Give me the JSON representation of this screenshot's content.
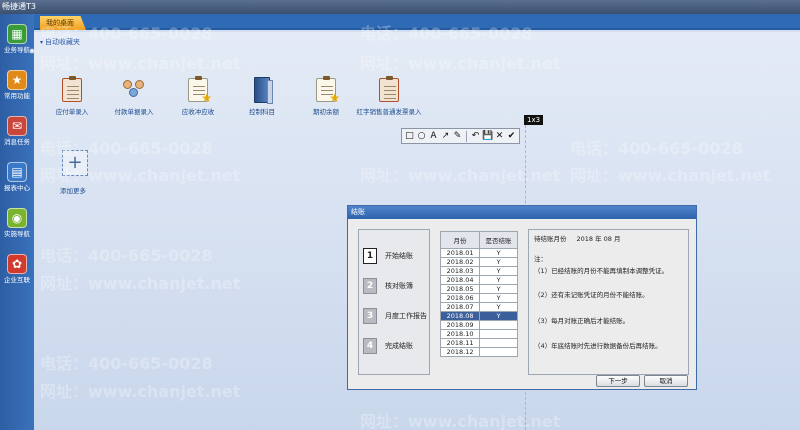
{
  "app": {
    "title": "畅捷通T3"
  },
  "sidebar": {
    "items": [
      {
        "label": "业务导航",
        "icon": "business-nav-icon",
        "glyph": "▦",
        "color": "#3a9b3a"
      },
      {
        "label": "常用功能",
        "icon": "star-icon",
        "glyph": "★",
        "color": "#e08a1a"
      },
      {
        "label": "消息任务",
        "icon": "task-icon",
        "glyph": "✉",
        "color": "#c8473a"
      },
      {
        "label": "报表中心",
        "icon": "report-icon",
        "glyph": "▤",
        "color": "#3a78c8"
      },
      {
        "label": "实施导航",
        "icon": "implement-nav-icon",
        "glyph": "◉",
        "color": "#7ab32e"
      },
      {
        "label": "企业互联",
        "icon": "enterprise-link-icon",
        "glyph": "✿",
        "color": "#d23a2e"
      }
    ]
  },
  "tabs": [
    {
      "label": "我的桌面"
    }
  ],
  "favorites": {
    "header": "自动收藏夹",
    "items": [
      {
        "label": "应付单录入"
      },
      {
        "label": "付款单据录入"
      },
      {
        "label": "应收冲应收"
      },
      {
        "label": "控制科目"
      },
      {
        "label": "期初余额"
      },
      {
        "label": "红字销售普通发票录入"
      }
    ],
    "add_label": "添加更多"
  },
  "screenshot_tool": {
    "size_badge": "1x3",
    "tools": [
      "□",
      "○",
      "A",
      "↗",
      "✎",
      "↶",
      "💾",
      "✕",
      "✔"
    ]
  },
  "watermarks": {
    "phone": "电话：400-665-0028",
    "site": "网址：www.chanjet.net"
  },
  "dialog": {
    "title": "结账",
    "steps": [
      {
        "num": "1",
        "label": "开始结账"
      },
      {
        "num": "2",
        "label": "核对账簿"
      },
      {
        "num": "3",
        "label": "月度工作报告"
      },
      {
        "num": "4",
        "label": "完成结账"
      }
    ],
    "table": {
      "headers": [
        "月份",
        "是否结账"
      ],
      "rows": [
        [
          "2018.01",
          "Y"
        ],
        [
          "2018.02",
          "Y"
        ],
        [
          "2018.03",
          "Y"
        ],
        [
          "2018.04",
          "Y"
        ],
        [
          "2018.05",
          "Y"
        ],
        [
          "2018.06",
          "Y"
        ],
        [
          "2018.07",
          "Y"
        ],
        [
          "2018.08",
          "Y"
        ],
        [
          "2018.09",
          ""
        ],
        [
          "2018.10",
          ""
        ],
        [
          "2018.11",
          ""
        ],
        [
          "2018.12",
          ""
        ]
      ],
      "selected_row": 7
    },
    "info": {
      "pending_label": "待结账月份",
      "pending_value": "2018 年 08 月",
      "note_title": "注：",
      "notes": [
        "（1）已经结账的月份不能再填制本调整凭证。",
        "（2）还有未记账凭证的月份不能结账。",
        "（3）每月对账正确后才能结账。",
        "（4）年底结账时先进行数据备份后再结账。"
      ]
    },
    "buttons": {
      "next": "下一步",
      "cancel": "取消"
    }
  }
}
